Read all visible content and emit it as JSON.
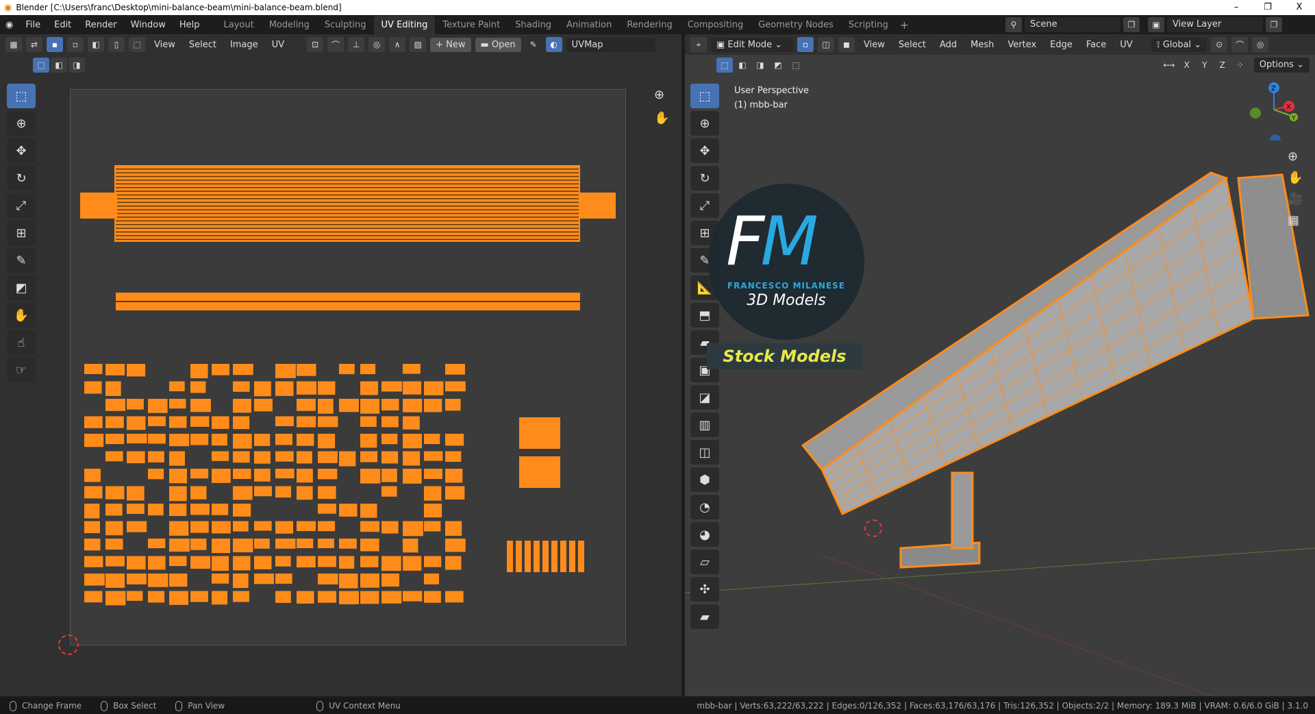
{
  "window": {
    "title": "Blender [C:\\Users\\franc\\Desktop\\mini-balance-beam\\mini-balance-beam.blend]",
    "minimize": "–",
    "maximize": "❐",
    "close": "X"
  },
  "menus": [
    "File",
    "Edit",
    "Render",
    "Window",
    "Help"
  ],
  "workspaces": [
    {
      "label": "Layout"
    },
    {
      "label": "Modeling"
    },
    {
      "label": "Sculpting"
    },
    {
      "label": "UV Editing",
      "active": true
    },
    {
      "label": "Texture Paint"
    },
    {
      "label": "Shading"
    },
    {
      "label": "Animation"
    },
    {
      "label": "Rendering"
    },
    {
      "label": "Compositing"
    },
    {
      "label": "Geometry Nodes"
    },
    {
      "label": "Scripting"
    }
  ],
  "add_workspace": "+",
  "scene": {
    "label": "Scene",
    "view_layer": "View Layer"
  },
  "uv_editor": {
    "menus": [
      "View",
      "Select",
      "Image",
      "UV"
    ],
    "new_label": "New",
    "open_label": "Open",
    "uvmap": "UVMap"
  },
  "viewport": {
    "mode": "Edit Mode",
    "menus": [
      "View",
      "Select",
      "Add",
      "Mesh",
      "Vertex",
      "Edge",
      "Face",
      "UV"
    ],
    "orientation": "Global",
    "axes": [
      "X",
      "Y",
      "Z"
    ],
    "options": "Options",
    "perspective": "User Perspective",
    "object": "(1) mbb-bar"
  },
  "watermark": {
    "initials_f": "F",
    "initials_m": "M",
    "name": "FRANCESCO MILANESE",
    "subtitle": "3D Models",
    "banner": "Stock Models"
  },
  "gizmo": {
    "z": "Z",
    "x": "X",
    "y": "Y"
  },
  "status": {
    "hints": [
      "Change Frame",
      "Box Select",
      "Pan View",
      "UV Context Menu"
    ],
    "stats": "mbb-bar | Verts:63,222/63,222 | Edges:0/126,352 | Faces:63,176/63,176 | Tris:126,352 | Objects:2/2 | Memory: 189.3 MiB | VRAM: 0.6/6.0 GiB | 3.1.0"
  },
  "colors": {
    "accent": "#4772b3",
    "mesh": "#ff8c1a",
    "face": "#9a9a9a"
  }
}
